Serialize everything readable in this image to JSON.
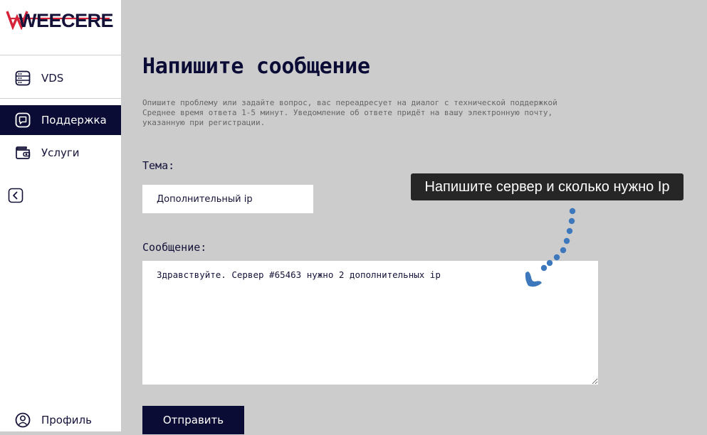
{
  "brand": {
    "logo_text": "WEECERE"
  },
  "sidebar": {
    "items": [
      {
        "label": "VDS",
        "icon": "server-icon"
      },
      {
        "label": "Поддержка",
        "icon": "chat-icon",
        "active": true
      },
      {
        "label": "Услуги",
        "icon": "wallet-icon"
      }
    ],
    "collapse_icon": "chevron-left-icon",
    "profile": {
      "label": "Профиль",
      "icon": "user-icon"
    }
  },
  "main": {
    "title": "Напишите сообщение",
    "description_line1": "Опишите проблему или задайте вопрос, вас переадресует на диалог с технической поддержкой",
    "description_line2": "Среднее время ответа 1-5 минут. Уведомление об ответе придёт на вашу электронную почту, указанную при регистрации.",
    "topic_label": "Тема:",
    "topic_value": "Дополнительный ip",
    "message_label": "Сообщение:",
    "message_value": "Здравствуйте. Сервер #65463 нужно 2 дополнительных ip",
    "send_label": "Отправить"
  },
  "annotation": {
    "callout_text": "Напишите сервер и сколько нужно Ip"
  },
  "colors": {
    "brand_navy": "#0b0c36",
    "logo_red": "#d5243a",
    "background": "#cccccc",
    "callout_bg": "#262626",
    "arrow_blue": "#3d78bd"
  }
}
